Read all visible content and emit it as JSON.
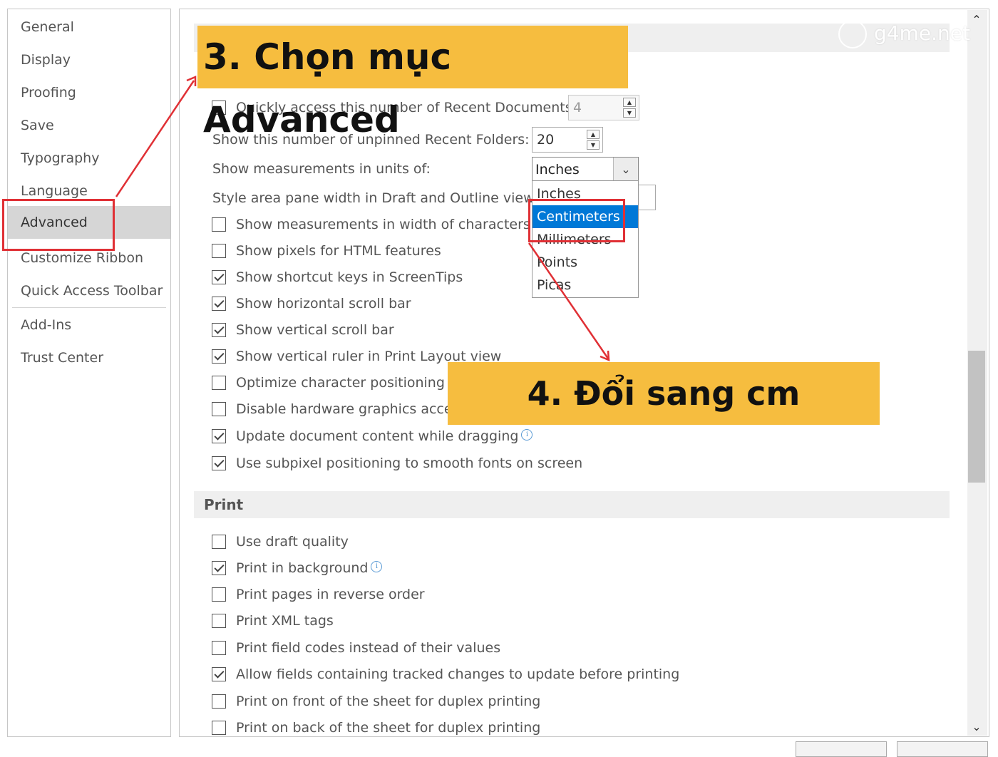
{
  "sidebar": {
    "items": [
      {
        "label": "General"
      },
      {
        "label": "Display"
      },
      {
        "label": "Proofing"
      },
      {
        "label": "Save"
      },
      {
        "label": "Typography"
      },
      {
        "label": "Language"
      },
      {
        "label": "Advanced"
      },
      {
        "label": "Customize Ribbon"
      },
      {
        "label": "Quick Access Toolbar"
      },
      {
        "label": "Add-Ins"
      },
      {
        "label": "Trust Center"
      }
    ],
    "selected": "Advanced"
  },
  "display": {
    "recent_docs": {
      "label": "Quickly access this number of Recent Documents:",
      "value": "4",
      "checked": false
    },
    "recent_folders": {
      "label": "Show this number of unpinned Recent Folders:",
      "value": "20"
    },
    "units": {
      "label": "Show measurements in units of:",
      "value": "Inches"
    },
    "style_area": {
      "label": "Style area pane width in Draft and Outline views:"
    },
    "units_options": [
      "Inches",
      "Centimeters",
      "Millimeters",
      "Points",
      "Picas"
    ],
    "units_highlighted": "Centimeters",
    "checkboxes": [
      {
        "label": "Show measurements in width of characters",
        "checked": false
      },
      {
        "label": "Show pixels for HTML features",
        "checked": false
      },
      {
        "label": "Show shortcut keys in ScreenTips",
        "checked": true
      },
      {
        "label": "Show horizontal scroll bar",
        "checked": true
      },
      {
        "label": "Show vertical scroll bar",
        "checked": true
      },
      {
        "label": "Show vertical ruler in Print Layout view",
        "checked": true
      },
      {
        "label": "Optimize character positioning for layout rather than readability",
        "checked": false
      },
      {
        "label": "Disable hardware graphics acceleration",
        "checked": false
      },
      {
        "label": "Update document content while dragging",
        "checked": true
      },
      {
        "label": "Use subpixel positioning to smooth fonts on screen",
        "checked": true
      }
    ]
  },
  "print": {
    "header": "Print",
    "checkboxes": [
      {
        "label": "Use draft quality",
        "checked": false
      },
      {
        "label": "Print in background",
        "checked": true
      },
      {
        "label": "Print pages in reverse order",
        "checked": false
      },
      {
        "label": "Print XML tags",
        "checked": false
      },
      {
        "label": "Print field codes instead of their values",
        "checked": false
      },
      {
        "label": "Allow fields containing tracked changes to update before printing",
        "checked": true
      },
      {
        "label": "Print on front of the sheet for duplex printing",
        "checked": false
      },
      {
        "label": "Print on back of the sheet for duplex printing",
        "checked": false
      }
    ]
  },
  "annotations": {
    "step3": "3. Chọn mục Advanced",
    "step4": "4.  Đổi sang cm",
    "watermark": "g4me.net",
    "highlight_color": "#f6bd3f",
    "box_color": "#e03035"
  },
  "info_glyph": "i",
  "scroll_up": "▲",
  "scroll_down": "▼",
  "combo_arrow": "⌄"
}
